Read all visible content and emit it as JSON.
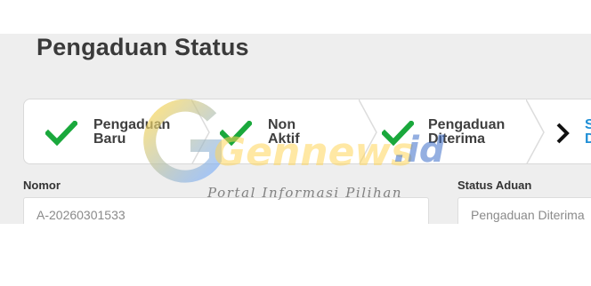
{
  "page": {
    "title": "Pengaduan Status"
  },
  "steps": [
    {
      "label": "Pengaduan Baru",
      "state": "completed",
      "icon": "check-icon"
    },
    {
      "label": "Non Aktif",
      "state": "completed",
      "icon": "check-icon"
    },
    {
      "label": "Pengaduan Diterima",
      "state": "completed",
      "icon": "check-icon"
    },
    {
      "label": "S D",
      "state": "current",
      "icon": "chevron-right-icon"
    }
  ],
  "form": {
    "nomor": {
      "label": "Nomor",
      "value": "A-20260301533"
    },
    "status_aduan": {
      "label": "Status Aduan",
      "value": "Pengaduan Diterima"
    }
  },
  "watermark": {
    "brand": "Gennews",
    "suffix": ".id",
    "tagline": "Portal Informasi Pilihan"
  },
  "colors": {
    "check": "#1aa83c",
    "accent": "#1f8fd6",
    "panel": "#eeeeee",
    "chevron": "#111111"
  }
}
